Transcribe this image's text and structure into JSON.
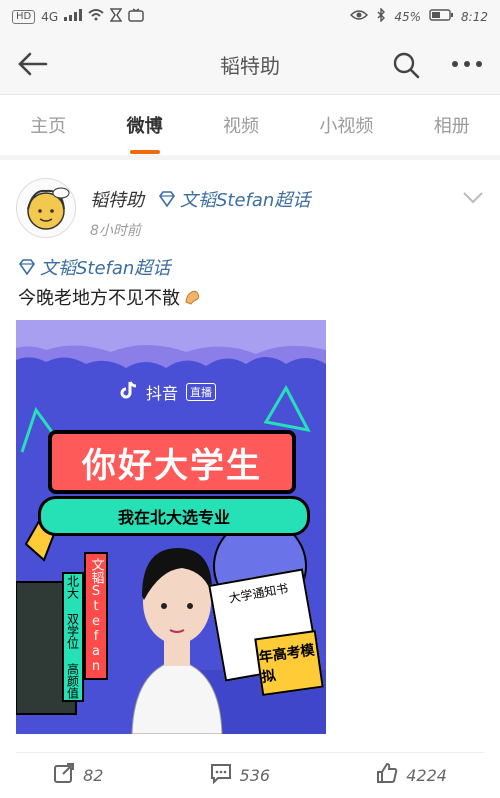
{
  "status_bar": {
    "left_items": [
      "HD",
      "4G",
      "signal-icon",
      "wifi-icon",
      "hourglass-icon",
      "tv-icon"
    ],
    "battery_percent": "45%",
    "time": "8:12"
  },
  "header": {
    "title": "韬特助",
    "back_icon": "back-arrow-icon",
    "search_icon": "search-icon",
    "more_icon": "more-icon"
  },
  "tabs": [
    {
      "label": "主页",
      "active": false
    },
    {
      "label": "微博",
      "active": true
    },
    {
      "label": "视频",
      "active": false
    },
    {
      "label": "小视频",
      "active": false
    },
    {
      "label": "相册",
      "active": false
    }
  ],
  "post": {
    "username": "韬特助",
    "topic_tag": "文韬Stefan超话",
    "time_ago": "8小时前",
    "topic_line": "文韬Stefan超话",
    "text": "今晚老地方不见不散",
    "emoji": "flexed-biceps-emoji",
    "poster": {
      "logo_text": "抖音",
      "logo_badge": "直播",
      "headline": "你好大学生",
      "subheadline": "我在北大选专业",
      "name_vertical": "文韬Stefan",
      "tags_vertical": "北大 双学位 高颜值",
      "letter_text": "大学通知书",
      "corner_text": "年高考模拟"
    },
    "actions": {
      "share_count": "82",
      "comment_count": "536",
      "like_count": "4224"
    }
  },
  "colors": {
    "accent": "#f06a10",
    "link_blue": "#3b6ea3",
    "poster_bg": "#4a50d6",
    "poster_red": "#ff5a5a",
    "poster_green": "#26e0b6"
  }
}
